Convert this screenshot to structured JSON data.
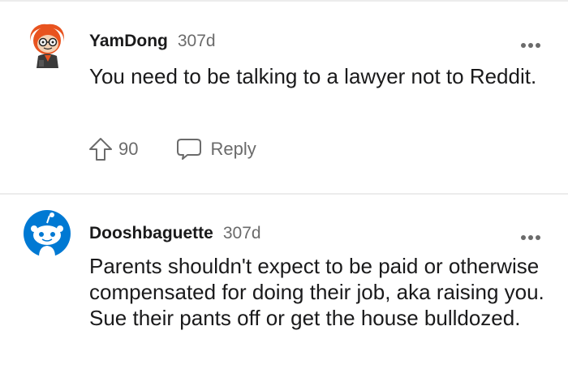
{
  "comments": [
    {
      "username": "YamDong",
      "age": "307d",
      "text": "You need to be talking to a lawyer not to Reddit.",
      "upvotes": "90",
      "reply_label": "Reply",
      "avatar_icon": "orange-haired-snoo-avatar",
      "more_icon": "more-options-icon"
    },
    {
      "username": "Dooshbaguette",
      "age": "307d",
      "text": "Parents shouldn't expect to be paid or otherwise compensated for doing their job, aka raising you. Sue their pants off or get the house bulldozed.",
      "avatar_icon": "default-snoo-avatar",
      "more_icon": "more-options-icon"
    }
  ],
  "colors": {
    "text": "#1a1a1b",
    "meta": "#6b6b6b",
    "divider": "#ececec",
    "avatar_blue": "#0079d3",
    "avatar_orange": "#e8531f"
  }
}
